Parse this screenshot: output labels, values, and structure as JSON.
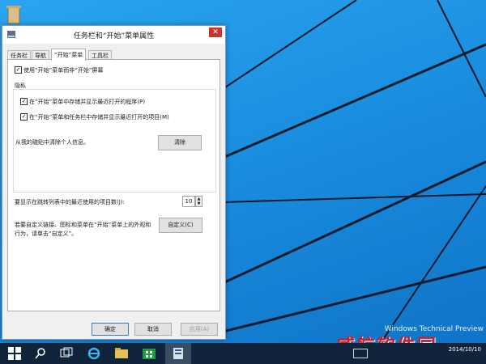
{
  "desktop": {
    "watermark_line1": "Windows Technical Preview",
    "logo": "威航软件园"
  },
  "dialog": {
    "title": "任务栏和“开始”菜单属性",
    "tabs": [
      "任务栏",
      "导航",
      "“开始”菜单",
      "工具栏"
    ],
    "use_start_menu_label": "使用“开始”菜单而非“开始”屏幕",
    "privacy_heading": "隐私",
    "privacy_opt1": "在“开始”菜单中存储并显示最近打开的程序(P)",
    "privacy_opt2": "在“开始”菜单和任务栏中存储并显示最近打开的项目(M)",
    "clear_desc": "从我的磁贴中清除个人信息。",
    "clear_button": "清除",
    "jumplist_label": "要显示在跳转列表中的最近使用的项目数(J):",
    "jumplist_value": "10",
    "customize_desc_line1": "若要自定义链接、图标和菜单在“开始”菜单上的外观和",
    "customize_desc_line2": "行为，请单击“自定义”。",
    "customize_button": "自定义(C)",
    "ok_button": "确定",
    "cancel_button": "取消",
    "apply_button": "应用(A)"
  },
  "taskbar": {
    "clock_date": "2014/10/10"
  },
  "colors": {
    "accent": "#1b8fe0",
    "taskbar": "#10243b",
    "close": "#c7352c"
  }
}
